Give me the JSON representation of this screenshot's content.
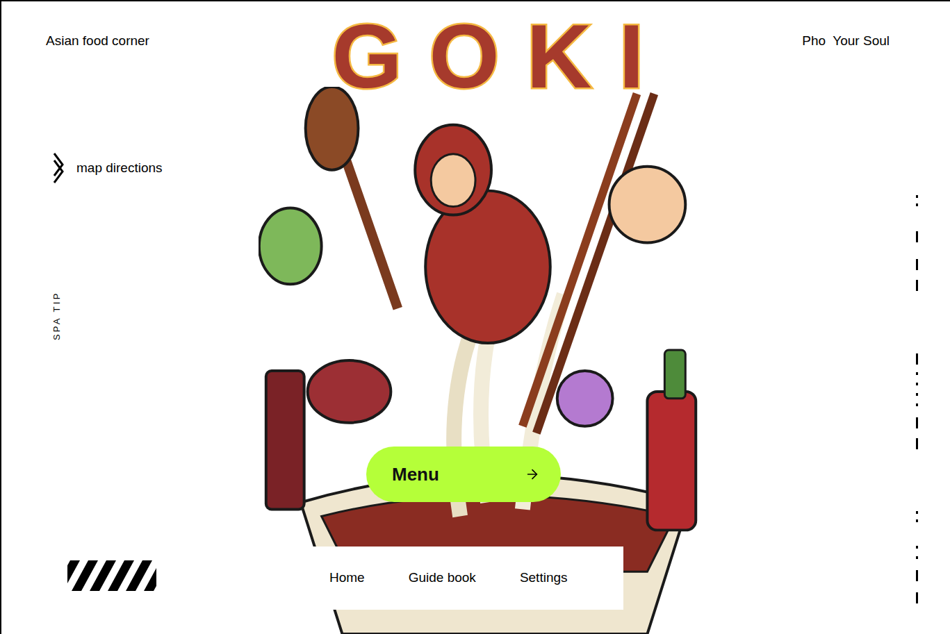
{
  "header": {
    "tagline": "Asian food corner",
    "logo": "GOKI",
    "slogan": "Pho  Your Soul"
  },
  "sidebar": {
    "directions": "map directions",
    "vertical_text": "SPA TIP"
  },
  "menu_button": {
    "label": "Menu"
  },
  "nav": [
    {
      "label": "Home"
    },
    {
      "label": "Guide book"
    },
    {
      "label": "Settings"
    }
  ]
}
